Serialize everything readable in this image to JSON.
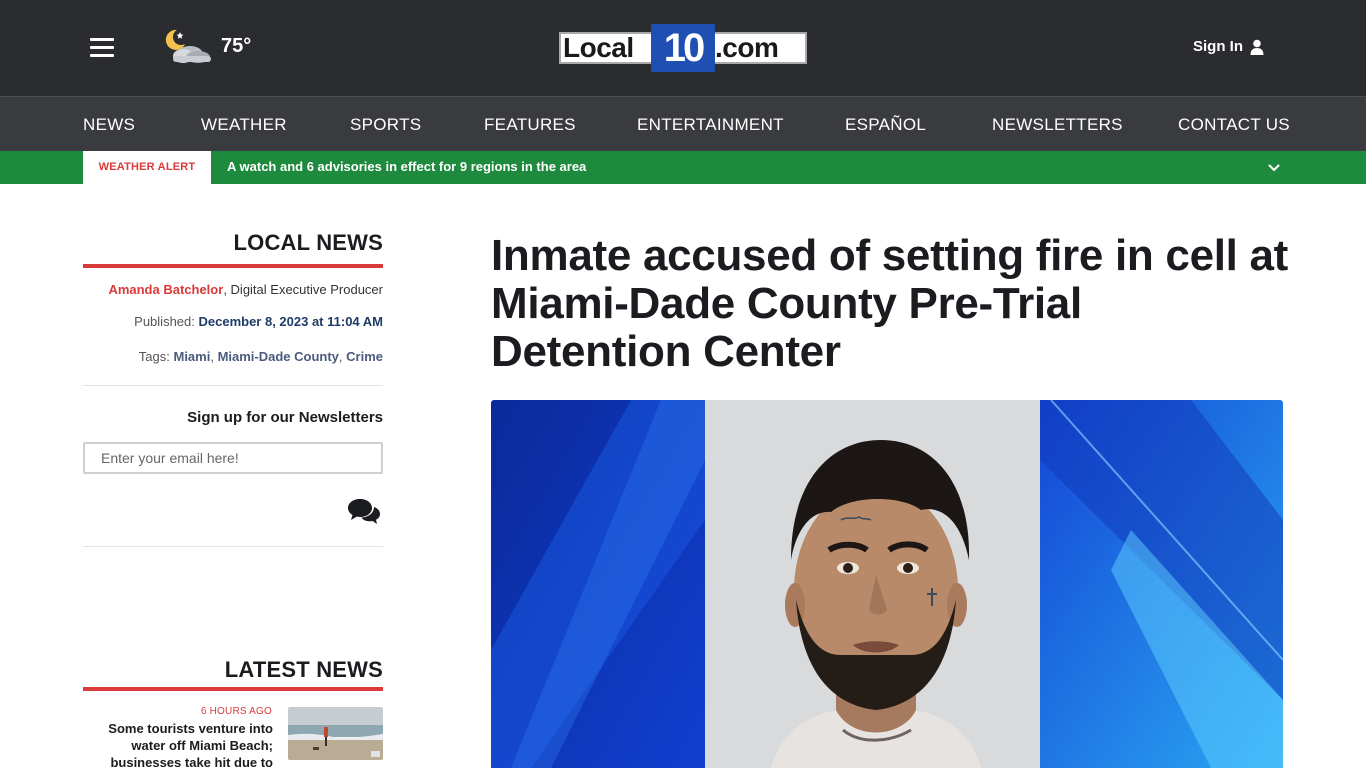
{
  "header": {
    "weather_temp": "75°",
    "weather_icon": "night-cloudy-icon",
    "logo_left": "Local",
    "logo_number": "10",
    "logo_right": ".com",
    "signin_label": "Sign In",
    "colors": {
      "topbar": "#2b2c30",
      "nav": "#3a3b3f",
      "logo_blue": "#1f4fb2"
    }
  },
  "nav": {
    "items": [
      {
        "label": "NEWS"
      },
      {
        "label": "WEATHER"
      },
      {
        "label": "SPORTS"
      },
      {
        "label": "FEATURES"
      },
      {
        "label": "ENTERTAINMENT"
      },
      {
        "label": "ESPAÑOL"
      },
      {
        "label": "NEWSLETTERS"
      },
      {
        "label": "CONTACT US"
      }
    ]
  },
  "alert": {
    "tag": "WEATHER ALERT",
    "text": "A watch and 6 advisories in effect for 9 regions in the area",
    "color": "#1e8a3e"
  },
  "sidebar": {
    "section_title": "LOCAL NEWS",
    "author_name": "Amanda Batchelor",
    "author_role": ", Digital Executive Producer",
    "published_label": "Published: ",
    "published_date": "December 8, 2023 at 11:04 AM",
    "tags_label": "Tags: ",
    "tags": [
      "Miami",
      "Miami-Dade County",
      "Crime"
    ],
    "newsletter_title": "Sign up for our Newsletters",
    "email_placeholder": "Enter your email here!",
    "latest_title": "LATEST NEWS",
    "latest": [
      {
        "time": "6 HOURS AGO",
        "headline": "Some tourists venture into water off Miami Beach; businesses take hit due to"
      }
    ],
    "accent": "#d93a3a"
  },
  "article": {
    "headline": "Inmate accused of setting fire in cell at Miami-Dade County Pre-Trial Detention Center"
  }
}
